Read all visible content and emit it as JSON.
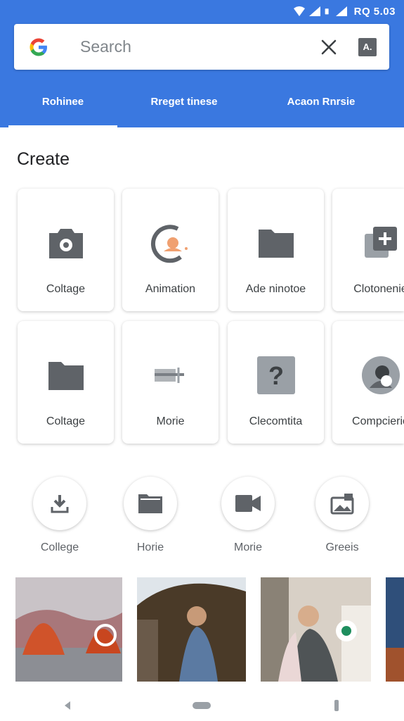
{
  "status_bar": {
    "time": "RQ 5.03"
  },
  "search": {
    "placeholder": "Search",
    "lens_label": "A."
  },
  "tabs": [
    {
      "label": "Rohinee",
      "active": true
    },
    {
      "label": "Rreget tinese",
      "active": false
    },
    {
      "label": "Acaon Rnrsie",
      "active": false
    }
  ],
  "section_title": "Create",
  "cards_row1": [
    {
      "label": "Coltage",
      "icon": "camera-icon"
    },
    {
      "label": "Animation",
      "icon": "animation-icon"
    },
    {
      "label": "Ade ninotoe",
      "icon": "folder-icon"
    },
    {
      "label": "Clotonenie",
      "icon": "collage-add-icon"
    }
  ],
  "cards_row2": [
    {
      "label": "Coltage",
      "icon": "folder-icon"
    },
    {
      "label": "Morie",
      "icon": "movie-icon"
    },
    {
      "label": "Clecomtita",
      "icon": "help-icon"
    },
    {
      "label": "Compcierio",
      "icon": "avatar-icon"
    }
  ],
  "quick_actions": [
    {
      "label": "College",
      "icon": "download-icon"
    },
    {
      "label": "Horie",
      "icon": "folder-icon"
    },
    {
      "label": "Morie",
      "icon": "video-icon"
    },
    {
      "label": "Greeis",
      "icon": "image-icon"
    }
  ],
  "colors": {
    "header_blue": "#3a78e0",
    "icon_gray": "#5f6368",
    "text_dark": "#202124"
  }
}
